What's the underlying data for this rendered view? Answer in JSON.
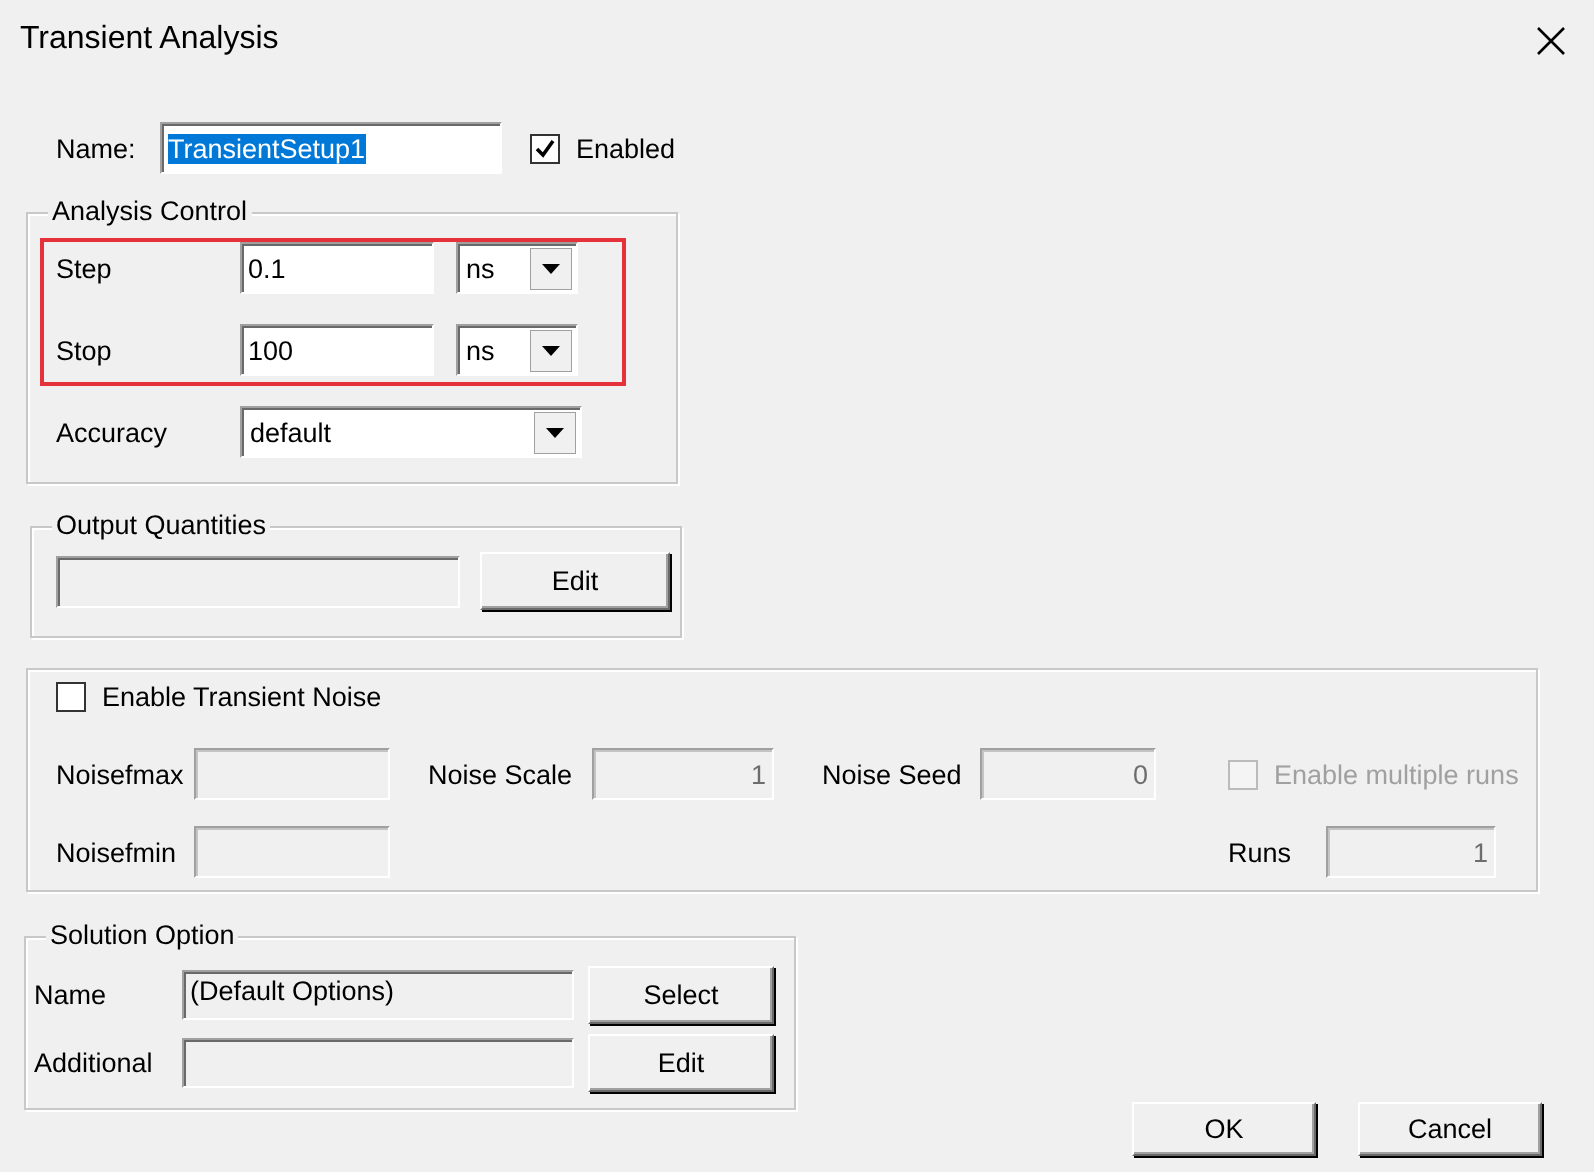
{
  "window": {
    "title": "Transient Analysis"
  },
  "name": {
    "label": "Name:",
    "value": "TransientSetup1",
    "text_selected": true
  },
  "enabled": {
    "label": "Enabled",
    "checked": true
  },
  "analysis_control": {
    "title": "Analysis Control",
    "highlighted": true,
    "rows": [
      {
        "label": "Step",
        "value": "0.1",
        "unit": "ns"
      },
      {
        "label": "Stop",
        "value": "100",
        "unit": "ns"
      }
    ],
    "accuracy": {
      "label": "Accuracy",
      "value": "default"
    }
  },
  "output_quantities": {
    "title": "Output Quantities",
    "button": "Edit"
  },
  "transient_noise": {
    "label": "Enable Transient Noise",
    "checked": false,
    "rows": [
      {
        "fields": [
          {
            "label": "Noisefmax",
            "disabled": true
          },
          {
            "label": "Noise Scale",
            "value": "1",
            "disabled": true
          },
          {
            "label": "Noise Seed",
            "value": "0",
            "disabled": true
          }
        ]
      },
      {
        "fields": [
          {
            "label": "Noisefmin",
            "disabled": true
          }
        ]
      }
    ],
    "multiple_runs": {
      "label": "Enable multiple runs",
      "checked": false,
      "disabled": true
    },
    "runs": {
      "label": "Runs",
      "value": "1",
      "disabled": true
    }
  },
  "solution_option": {
    "title": "Solution Option",
    "rows": [
      {
        "label": "Name",
        "value": "(Default Options)",
        "button": "Select"
      },
      {
        "label": "Additional",
        "button": "Edit"
      }
    ]
  },
  "buttons": [
    "OK",
    "Cancel"
  ]
}
